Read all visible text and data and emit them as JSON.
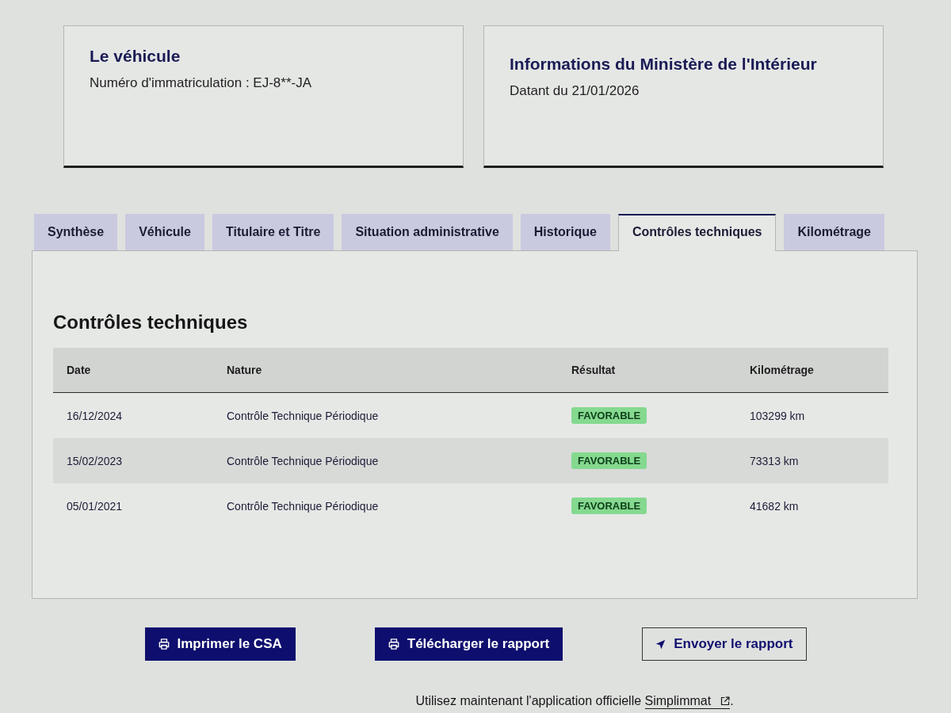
{
  "cards": [
    {
      "title": "Le véhicule",
      "text": "Numéro d'immatriculation : EJ-8**-JA"
    },
    {
      "title": "Informations du Ministère de l'Intérieur",
      "text": "Datant du 21/01/2026"
    }
  ],
  "tabs": [
    {
      "label": "Synthèse",
      "selected": false
    },
    {
      "label": "Véhicule",
      "selected": false
    },
    {
      "label": "Titulaire et Titre",
      "selected": false
    },
    {
      "label": "Situation administrative",
      "selected": false
    },
    {
      "label": "Historique",
      "selected": false
    },
    {
      "label": "Contrôles techniques",
      "selected": true
    },
    {
      "label": "Kilométrage",
      "selected": false
    }
  ],
  "section": {
    "title": "Contrôles techniques",
    "table": {
      "columns": [
        "Date",
        "Nature",
        "Résultat",
        "Kilométrage"
      ],
      "rows": [
        {
          "date": "16/12/2024",
          "nature": "Contrôle Technique Périodique",
          "result": "FAVORABLE",
          "mileage": "103299 km"
        },
        {
          "date": "15/02/2023",
          "nature": "Contrôle Technique Périodique",
          "result": "FAVORABLE",
          "mileage": "73313 km"
        },
        {
          "date": "05/01/2021",
          "nature": "Contrôle Technique Périodique",
          "result": "FAVORABLE",
          "mileage": "41682 km"
        }
      ]
    }
  },
  "buttons": [
    {
      "label": "Imprimer le CSA",
      "kind": "primary"
    },
    {
      "label": "Télécharger le rapport",
      "kind": "primary"
    },
    {
      "label": "Envoyer le rapport",
      "kind": "secondary"
    }
  ],
  "footer": {
    "text": "Utilisez maintenant l'application officielle",
    "link": "Simplimmat",
    "end": "."
  }
}
